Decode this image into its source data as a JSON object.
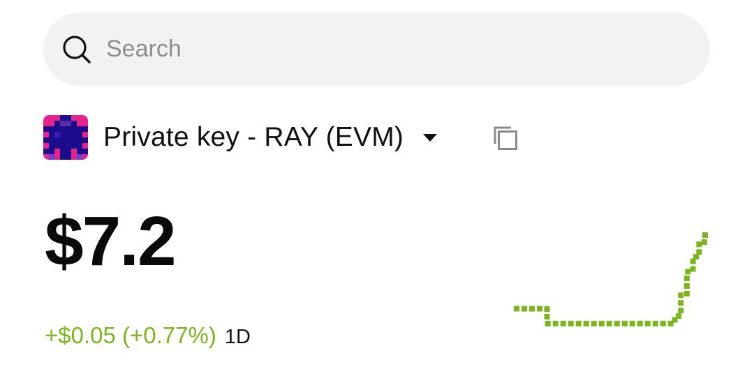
{
  "search": {
    "placeholder": "Search",
    "icon": "search-icon"
  },
  "account": {
    "name": "Private key - RAY (EVM)",
    "avatar": "pixel-avatar",
    "dropdown_icon": "chevron-down-icon",
    "copy_icon": "copy-icon"
  },
  "portfolio": {
    "balance": "$7.2",
    "change": "+$0.05 (+0.77%)",
    "period": "1D"
  },
  "colors": {
    "positive": "#7db51f",
    "search_bg": "#f2f2f2",
    "text": "#111111"
  },
  "chart_data": {
    "type": "line",
    "style": "dotted-square-sparkline",
    "color": "#7db51f",
    "x": [
      0,
      1,
      2,
      3,
      4,
      5,
      6,
      7,
      8,
      9,
      10,
      11,
      12,
      13,
      14,
      15,
      16,
      17,
      18,
      19,
      20,
      21,
      22,
      23,
      24,
      25,
      26,
      27,
      28,
      29,
      30,
      31
    ],
    "values": [
      7.15,
      7.15,
      7.15,
      7.15,
      7.15,
      7.14,
      7.14,
      7.14,
      7.14,
      7.14,
      7.14,
      7.14,
      7.14,
      7.14,
      7.14,
      7.14,
      7.14,
      7.14,
      7.14,
      7.14,
      7.14,
      7.14,
      7.14,
      7.14,
      7.14,
      7.14,
      7.145,
      7.16,
      7.175,
      7.185,
      7.195,
      7.2
    ],
    "ylim": [
      7.13,
      7.21
    ]
  }
}
